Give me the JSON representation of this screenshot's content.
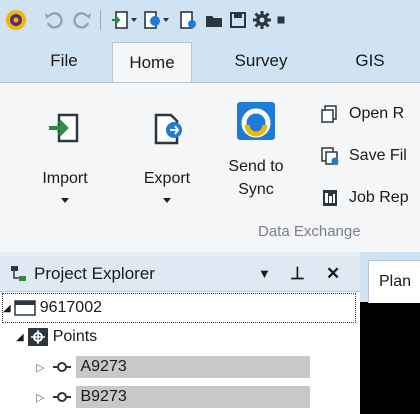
{
  "quick_access": {
    "icons": [
      "app-logo-icon",
      "undo-icon",
      "redo-icon",
      "import-icon",
      "export-icon",
      "new-doc-icon",
      "open-folder-icon",
      "save-icon",
      "settings-icon"
    ]
  },
  "tabs": [
    {
      "label": "File",
      "active": false
    },
    {
      "label": "Home",
      "active": true
    },
    {
      "label": "Survey",
      "active": false
    },
    {
      "label": "GIS",
      "active": false
    }
  ],
  "ribbon": {
    "buttons": {
      "import": {
        "label": "Import"
      },
      "export": {
        "label": "Export"
      },
      "send_to_sync": {
        "line1": "Send to",
        "line2": "Sync"
      }
    },
    "small_buttons": {
      "open": {
        "label": "Open R"
      },
      "save_file": {
        "label": "Save Fil"
      },
      "job_report": {
        "label": "Job Rep"
      }
    },
    "group_label": "Data Exchange"
  },
  "project_explorer": {
    "title": "Project Explorer",
    "controls": {
      "dropdown": "▼",
      "pin": "⊥",
      "close": "✕"
    }
  },
  "tree": {
    "root": "9617002",
    "points": "Points",
    "items": [
      {
        "label": "A9273"
      },
      {
        "label": "B9273"
      }
    ]
  },
  "right_tab": {
    "label": "Plan"
  },
  "colors": {
    "ribbon_bg": "#cfe3f3",
    "panel_bg": "#f4f6f8",
    "selection": "#c8c8c8",
    "accent_blue": "#1e7bd6",
    "accent_green": "#2d8a3e"
  }
}
